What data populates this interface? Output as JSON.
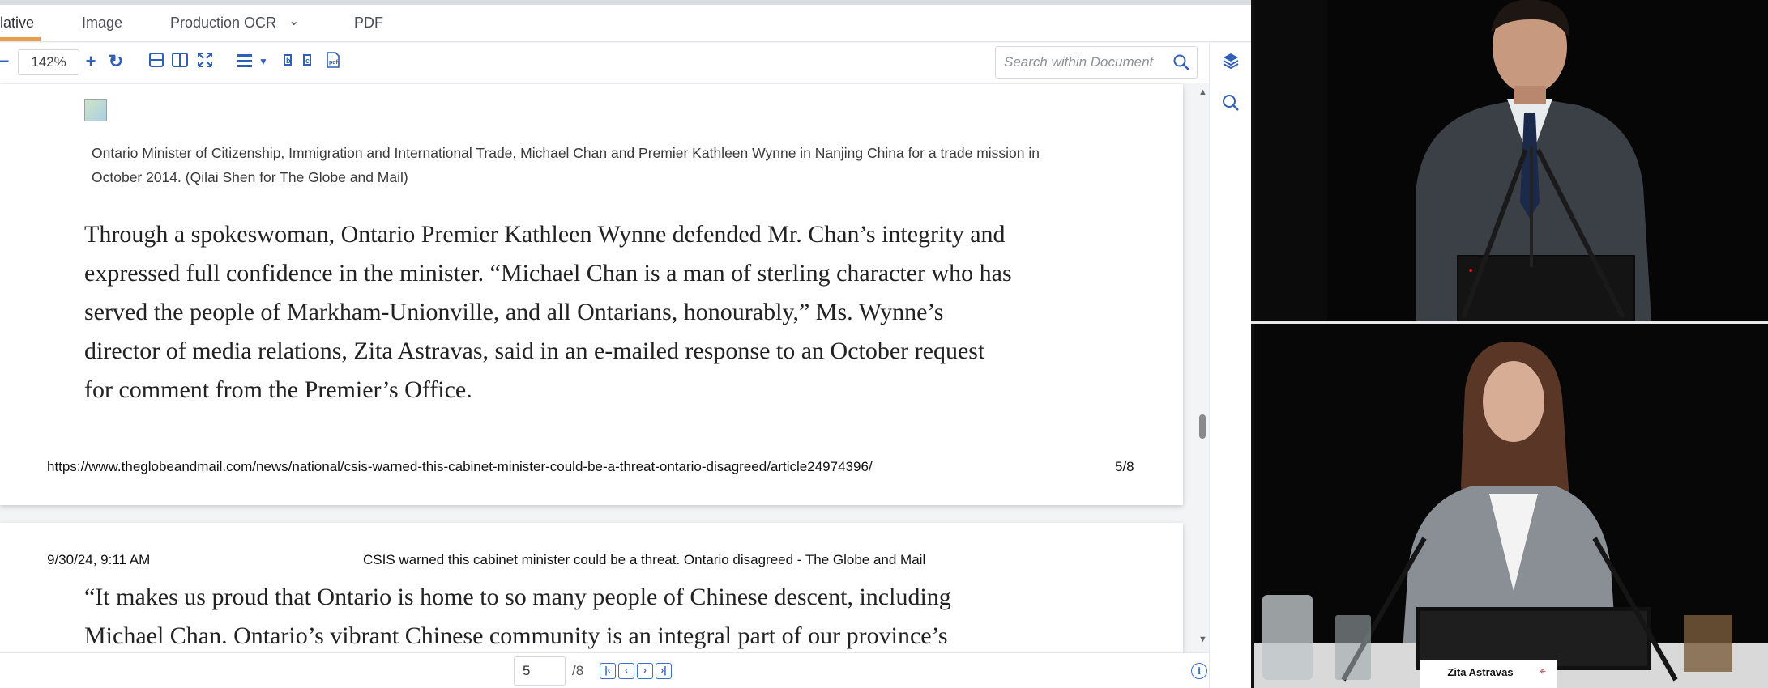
{
  "tabs": {
    "native": "lative",
    "image": "Image",
    "production_ocr": "Production OCR",
    "pdf": "PDF"
  },
  "toolbar": {
    "zoom": "142%",
    "search_placeholder": "Search within Document",
    "icons": [
      "zoom-out-icon",
      "zoom-in-icon",
      "rotate-icon",
      "fit-width-icon",
      "two-page-icon",
      "fullscreen-icon",
      "page-layout-icon",
      "image-tools-icon",
      "pdf-icon",
      "search-icon",
      "layers-icon"
    ]
  },
  "page1": {
    "caption": "Ontario Minister of Citizenship, Immigration and International Trade, Michael Chan and Premier Kathleen Wynne in Nanjing China for a trade mission in October 2014. (Qilai Shen for The Globe and Mail)",
    "body_lines": [
      "Through a spokeswoman, Ontario Premier Kathleen Wynne defended Mr. Chan’s integrity and",
      "expressed full confidence in the minister. “Michael Chan is a man of sterling character who has",
      "served the people of Markham-Unionville, and all Ontarians, honourably,” Ms. Wynne’s",
      "director of media relations, Zita Astravas, said in an e-mailed response to an October request",
      "for comment from the Premier’s Office."
    ],
    "footer_url": "https://www.theglobeandmail.com/news/national/csis-warned-this-cabinet-minister-could-be-a-threat-ontario-disagreed/article24974396/",
    "footer_page": "5/8"
  },
  "page2": {
    "header_date": "9/30/24, 9:11 AM",
    "header_title": "CSIS warned this cabinet minister could be a threat. Ontario disagreed - The Globe and Mail",
    "body_lines": [
      "“It makes us proud that Ontario is home to so many people of Chinese descent, including",
      "Michael Chan. Ontario’s vibrant Chinese community is an integral part of our province’s"
    ]
  },
  "pagenav": {
    "current_page": "5",
    "total": "/8"
  },
  "video": {
    "name_plate": "Zita Astravas"
  },
  "colors": {
    "accent": "#e6a04a",
    "icon_blue": "#2f5fb8"
  }
}
